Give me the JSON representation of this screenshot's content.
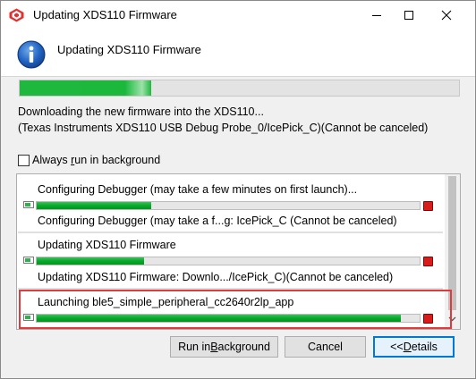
{
  "window": {
    "title": "Updating XDS110 Firmware"
  },
  "header": {
    "title": "Updating XDS110 Firmware",
    "icon": "info-icon"
  },
  "main_progress": {
    "percent": 30
  },
  "messages": {
    "line1": "Downloading the new firmware into the XDS110...",
    "line2": "(Texas Instruments XDS110 USB Debug Probe_0/IcePick_C)(Cannot be canceled)"
  },
  "background_checkbox": {
    "label_pre": "Always ",
    "label_u": "r",
    "label_post": "un in background",
    "checked": false
  },
  "jobs": [
    {
      "name": "Configuring Debugger (may take a few minutes on first launch)...",
      "sub": "Configuring Debugger (may take a f...g: IcePick_C (Cannot be canceled)",
      "progress": 30
    },
    {
      "name": "Updating XDS110 Firmware",
      "sub": "Updating XDS110 Firmware: Downlo.../IcePick_C)(Cannot be canceled)",
      "progress": 28
    },
    {
      "name": "Launching ble5_simple_peripheral_cc2640r2lp_app",
      "sub": "",
      "progress": 95
    }
  ],
  "buttons": {
    "run_pre": "Run in ",
    "run_u": "B",
    "run_post": "ackground",
    "cancel": "Cancel",
    "details_pre": "<< ",
    "details_u": "D",
    "details_post": "etails"
  },
  "colors": {
    "progress_green": "#0aa82b",
    "highlight_red": "#e03a3a",
    "stop_red": "#d81c1c",
    "default_button_border": "#0078d7"
  }
}
